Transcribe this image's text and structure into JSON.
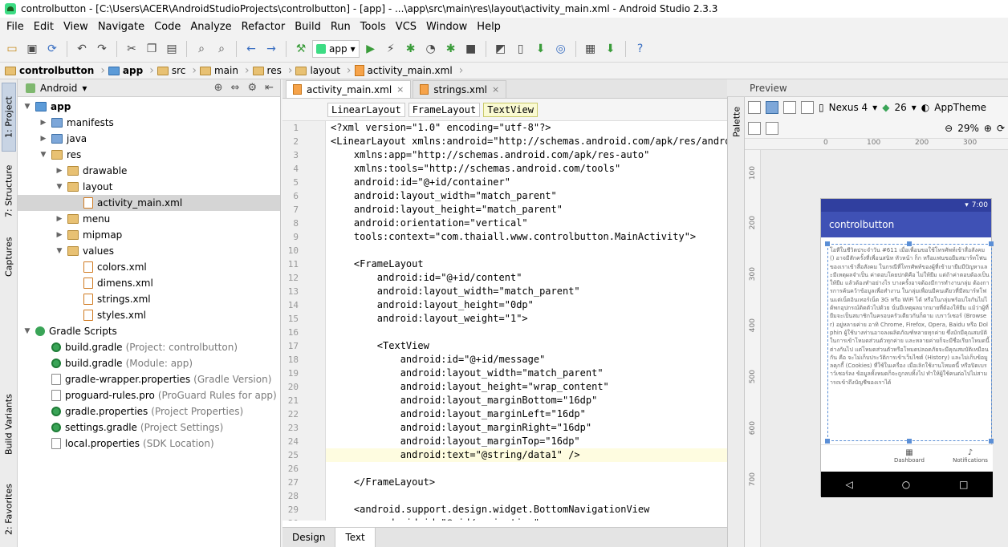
{
  "title": "controlbutton - [C:\\Users\\ACER\\AndroidStudioProjects\\controlbutton] - [app] - ...\\app\\src\\main\\res\\layout\\activity_main.xml - Android Studio 2.3.3",
  "menu": [
    "File",
    "Edit",
    "View",
    "Navigate",
    "Code",
    "Analyze",
    "Refactor",
    "Build",
    "Run",
    "Tools",
    "VCS",
    "Window",
    "Help"
  ],
  "toolbar": {
    "run_config": "app"
  },
  "breadcrumb": [
    "controlbutton",
    "app",
    "src",
    "main",
    "res",
    "layout",
    "activity_main.xml"
  ],
  "left_strip": [
    "1: Project",
    "7: Structure",
    "Captures",
    "Build Variants",
    "2: Favorites"
  ],
  "project": {
    "view": "Android",
    "tree": [
      {
        "label": "app",
        "depth": 0,
        "icon": "app",
        "twisty": "▼"
      },
      {
        "label": "manifests",
        "depth": 1,
        "icon": "fold-blue",
        "twisty": "▶"
      },
      {
        "label": "java",
        "depth": 1,
        "icon": "fold-blue",
        "twisty": "▶"
      },
      {
        "label": "res",
        "depth": 1,
        "icon": "fold",
        "twisty": "▼"
      },
      {
        "label": "drawable",
        "depth": 2,
        "icon": "fold",
        "twisty": "▶"
      },
      {
        "label": "layout",
        "depth": 2,
        "icon": "fold",
        "twisty": "▼"
      },
      {
        "label": "activity_main.xml",
        "depth": 3,
        "icon": "xml",
        "twisty": "",
        "selected": true
      },
      {
        "label": "menu",
        "depth": 2,
        "icon": "fold",
        "twisty": "▶"
      },
      {
        "label": "mipmap",
        "depth": 2,
        "icon": "fold",
        "twisty": "▶"
      },
      {
        "label": "values",
        "depth": 2,
        "icon": "fold",
        "twisty": "▼"
      },
      {
        "label": "colors.xml",
        "depth": 3,
        "icon": "xml",
        "twisty": ""
      },
      {
        "label": "dimens.xml",
        "depth": 3,
        "icon": "xml",
        "twisty": ""
      },
      {
        "label": "strings.xml",
        "depth": 3,
        "icon": "xml",
        "twisty": ""
      },
      {
        "label": "styles.xml",
        "depth": 3,
        "icon": "xml",
        "twisty": ""
      },
      {
        "label": "Gradle Scripts",
        "depth": 0,
        "icon": "gs",
        "twisty": "▼"
      },
      {
        "label": "build.gradle",
        "sub": "(Project: controlbutton)",
        "depth": 1,
        "icon": "gradle",
        "twisty": ""
      },
      {
        "label": "build.gradle",
        "sub": "(Module: app)",
        "depth": 1,
        "icon": "gradle",
        "twisty": ""
      },
      {
        "label": "gradle-wrapper.properties",
        "sub": "(Gradle Version)",
        "depth": 1,
        "icon": "prop",
        "twisty": ""
      },
      {
        "label": "proguard-rules.pro",
        "sub": "(ProGuard Rules for app)",
        "depth": 1,
        "icon": "prop",
        "twisty": ""
      },
      {
        "label": "gradle.properties",
        "sub": "(Project Properties)",
        "depth": 1,
        "icon": "gradle",
        "twisty": ""
      },
      {
        "label": "settings.gradle",
        "sub": "(Project Settings)",
        "depth": 1,
        "icon": "gradle",
        "twisty": ""
      },
      {
        "label": "local.properties",
        "sub": "(SDK Location)",
        "depth": 1,
        "icon": "prop",
        "twisty": ""
      }
    ]
  },
  "editor": {
    "tabs": [
      {
        "label": "activity_main.xml",
        "active": true
      },
      {
        "label": "strings.xml",
        "active": false
      }
    ],
    "context": [
      "LinearLayout",
      "FrameLayout",
      "TextView"
    ],
    "lines": [
      "<?xml version=\"1.0\" encoding=\"utf-8\"?>",
      "<LinearLayout xmlns:android=\"http://schemas.android.com/apk/res/android\"",
      "    xmlns:app=\"http://schemas.android.com/apk/res-auto\"",
      "    xmlns:tools=\"http://schemas.android.com/tools\"",
      "    android:id=\"@+id/container\"",
      "    android:layout_width=\"match_parent\"",
      "    android:layout_height=\"match_parent\"",
      "    android:orientation=\"vertical\"",
      "    tools:context=\"com.thaiall.www.controlbutton.MainActivity\">",
      "",
      "    <FrameLayout",
      "        android:id=\"@+id/content\"",
      "        android:layout_width=\"match_parent\"",
      "        android:layout_height=\"0dp\"",
      "        android:layout_weight=\"1\">",
      "",
      "        <TextView",
      "            android:id=\"@+id/message\"",
      "            android:layout_width=\"match_parent\"",
      "            android:layout_height=\"wrap_content\"",
      "            android:layout_marginBottom=\"16dp\"",
      "            android:layout_marginLeft=\"16dp\"",
      "            android:layout_marginRight=\"16dp\"",
      "            android:layout_marginTop=\"16dp\"",
      "            android:text=\"@string/data1\" />",
      "",
      "    </FrameLayout>",
      "",
      "    <android.support.design.widget.BottomNavigationView",
      "        android:id=\"@+id/navigation\""
    ],
    "highlight_line": 25,
    "bottom_tabs": [
      "Design",
      "Text"
    ]
  },
  "preview": {
    "title": "Preview",
    "palette": "Palette",
    "device": "Nexus 4",
    "api": "26",
    "theme": "AppTheme",
    "zoom": "29%",
    "ruler_h": [
      "0",
      "100",
      "200",
      "300"
    ],
    "ruler_v": [
      "100",
      "200",
      "300",
      "400",
      "500",
      "600",
      "700"
    ],
    "phone": {
      "time": "7:00",
      "app_title": "controlbutton",
      "text": "โอทีในชีวิตประจำวัน #611 เมื่อเพื่อนขอใช้โทรศัพท์เข้าสื่อสังคม () อาจมีสักครั้งที่เพื่อนสนิท หัวหน้า ก็ก หรือแฟนขอยืมสมาร์ทโฟนของเราเข้าสื่อสังคม ในกรณีที่โทรศัพท์ของผู้ที่เข้ามายืมมีปัญหาและมีเหตุผลจำเป็น ค่าตอบโดยปกติคือ ไม่ให้ยืม แต่ถ้าค่าตอบต้องเป็นให้ยืม แล้วต้องทำอย่างไร บางครั้งอาจต้องมีการทำงานกลุ่ม ต้องการการค้นคว้าข้อมูลเพื่อทำงาน ในกลุ่มเพื่อนมีคนเดียวที่มีสมาร์ทโฟนแต่เน็ตอินเทอร์เน็ต 3G หรือ WiFi ได้ หรือในกลุ่มพร้อมใจกันไม่ได้พกอุปกรณ์ติดตัวไปด้วย นั่นมีเหตุผลมากมายที่ต้องให้ยืม แม้ว่าผู้ที่ยืมจะเป็นสมาชิกในครอบครัวเดียวกันก็ตาม เบราว์เซอร์ (Browser) อยู่หลายค่าย อาทิ Chrome, Firefox, Opera, Baidu หรือ Dolphin ผู้ใช้บางท่านอาจลงผลิตภัณฑ์หลายทุกค่าย ซึ่งมักมีคุณสมบัติในการเข้าโหมดส่วนตัวทุกค่าย และหลายค่ายก็จะมีชื่อเรียกโหมดนี้ต่างกันไป แต่โหมดส่วนตัวหรือโหมดปลอดภัยจะมีคุณสมบัติเหมือนกัน คือ จะไม่เก็บประวัติการเข้าเว็บไซต์ (History) และไม่เก็บข้อมูลคุกกี้ (Cookies) ที่ใช้ในเครื่อง เมื่อเลิกใช้งานโหมดนี้ หรือปิดเบราว์เซอร์ลง ข้อมูลทั้งหมดก็จะถูกลบทิ้งไป ทำให้ผู้ใช้คนต่อไปไม่สามารถเข้าถึงบัญชีของเราได้",
      "nav": [
        "Dashboard",
        "Notifications"
      ]
    }
  }
}
